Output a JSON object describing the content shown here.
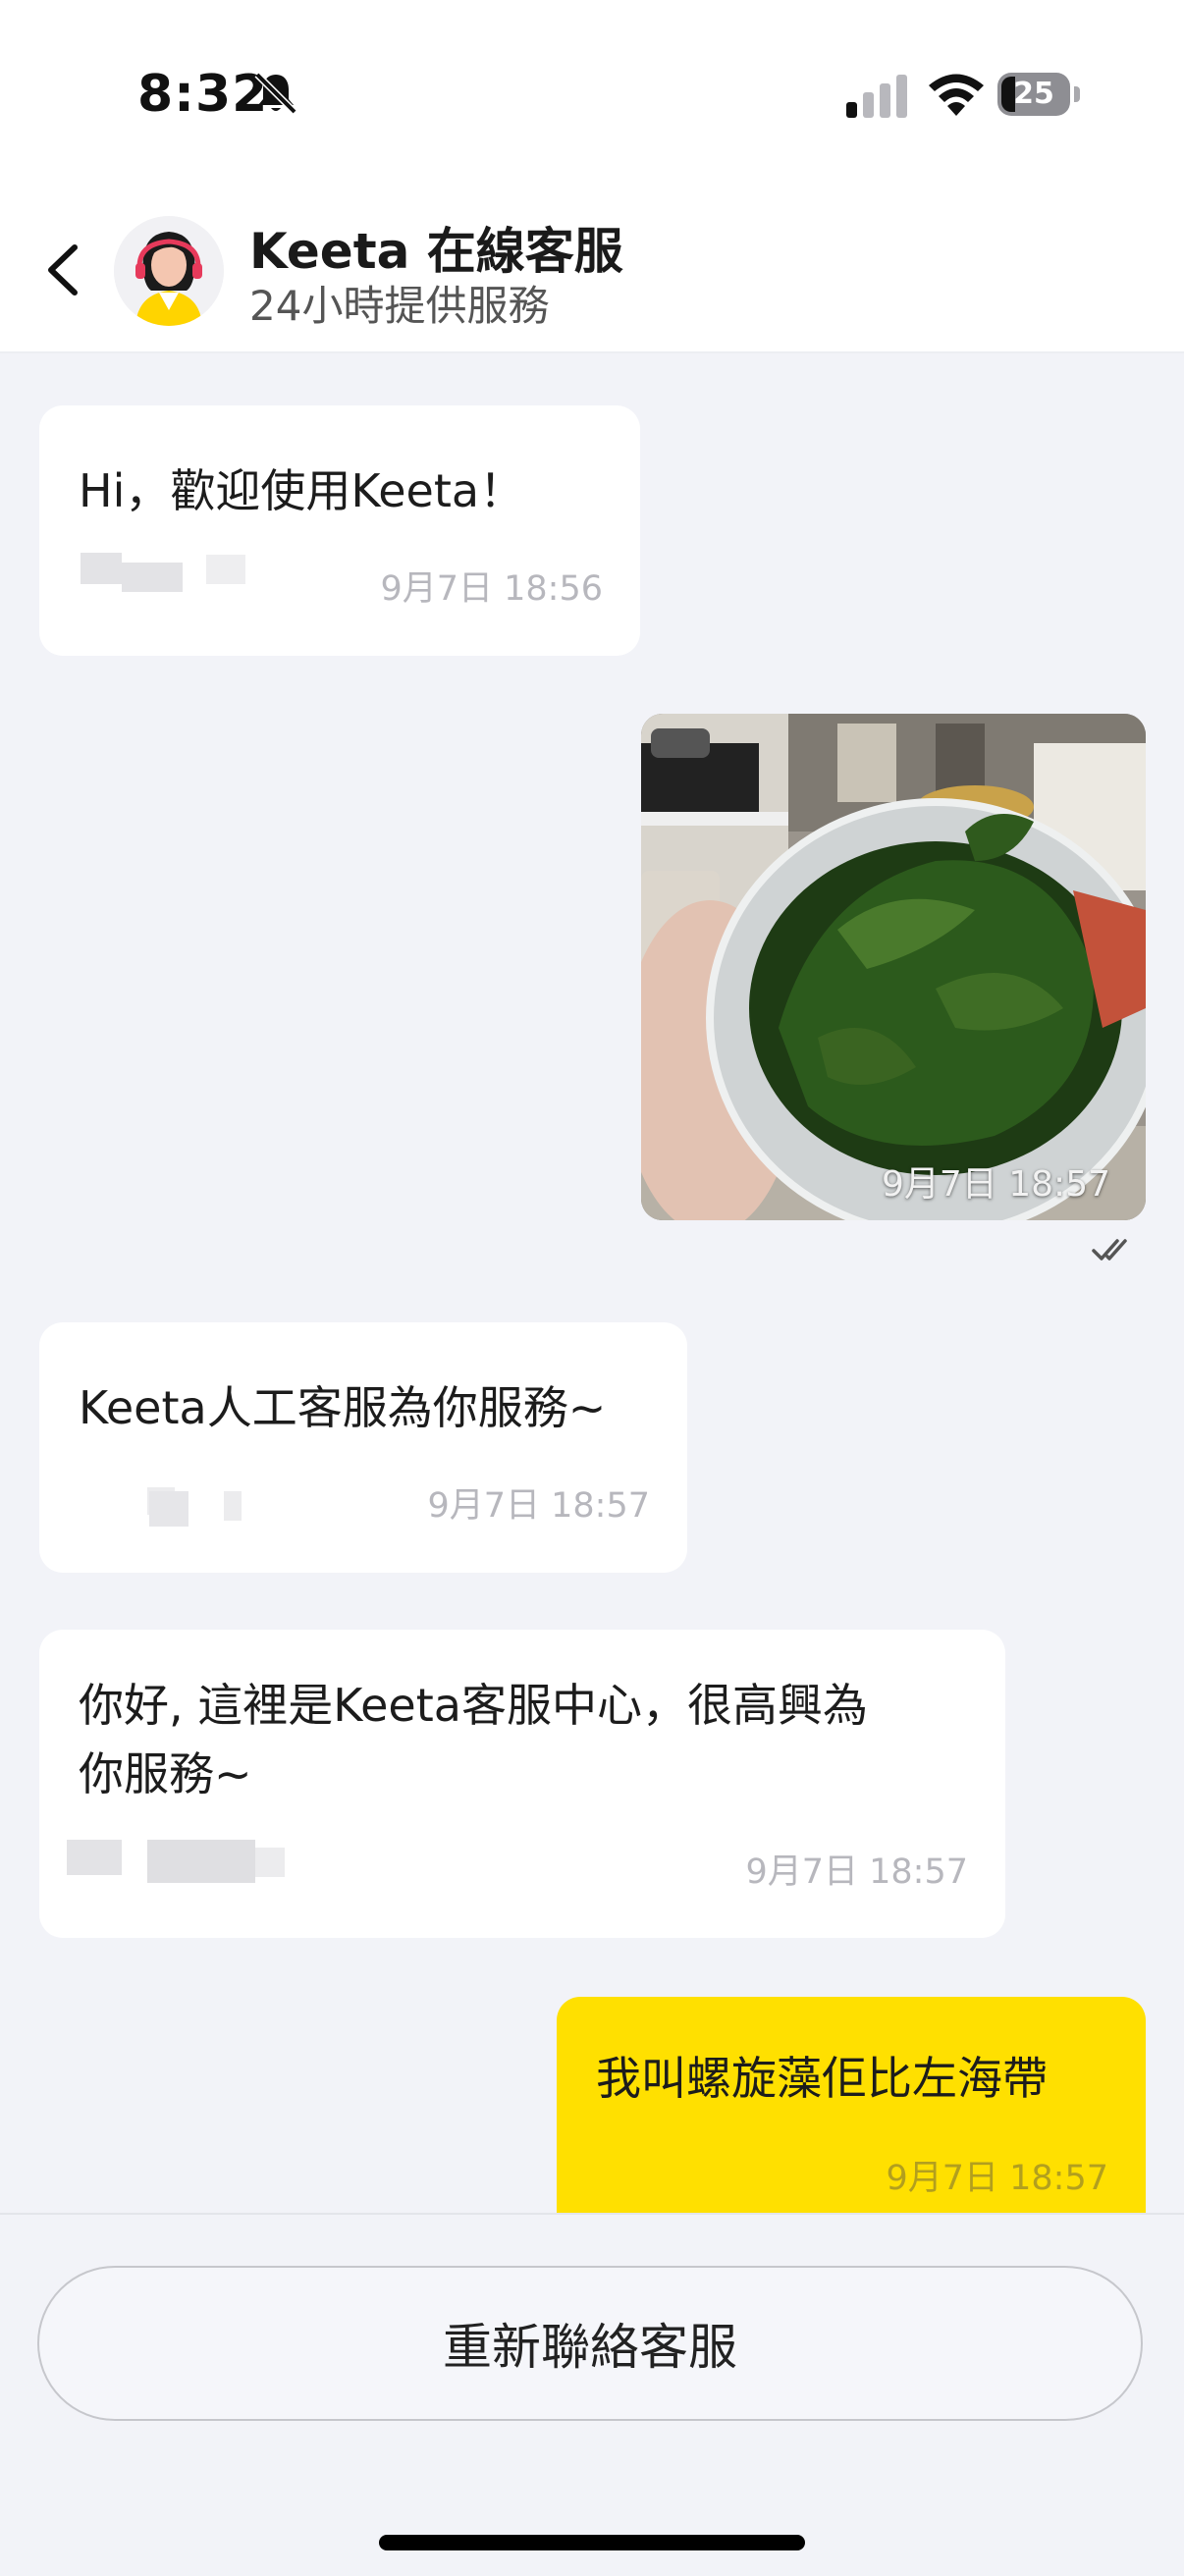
{
  "status_bar": {
    "time": "8:32",
    "battery": "25",
    "icons": [
      "bell-slash-icon",
      "cellular-signal-icon",
      "wifi-icon",
      "battery-icon"
    ]
  },
  "header": {
    "back_icon": "chevron-left-icon",
    "title": "Keeta 在線客服",
    "subtitle": "24小時提供服務"
  },
  "messages": [
    {
      "side": "left",
      "text": "Hi，歡迎使用Keeta！",
      "time": "9月7日 18:56"
    },
    {
      "side": "right",
      "type": "image",
      "image_desc": "seaweed-in-plastic-container-photo",
      "time": "9月7日 18:57",
      "status_icon": "double-check-icon"
    },
    {
      "side": "left",
      "text": "Keeta人工客服為你服務~",
      "time": "9月7日 18:57"
    },
    {
      "side": "left",
      "text_line1": "你好, 這裡是Keeta客服中心，很高興為",
      "text_line2": "你服務~",
      "time": "9月7日 18:57"
    },
    {
      "side": "right",
      "text": "我叫螺旋藻佢比左海帶",
      "time": "9月7日 18:57",
      "bubble_color": "#ffe000"
    }
  ],
  "footer": {
    "reconnect_label": "重新聯絡客服"
  },
  "colors": {
    "background": "#f2f3f8",
    "user_bubble": "#ffe000",
    "agent_bubble": "#ffffff"
  }
}
